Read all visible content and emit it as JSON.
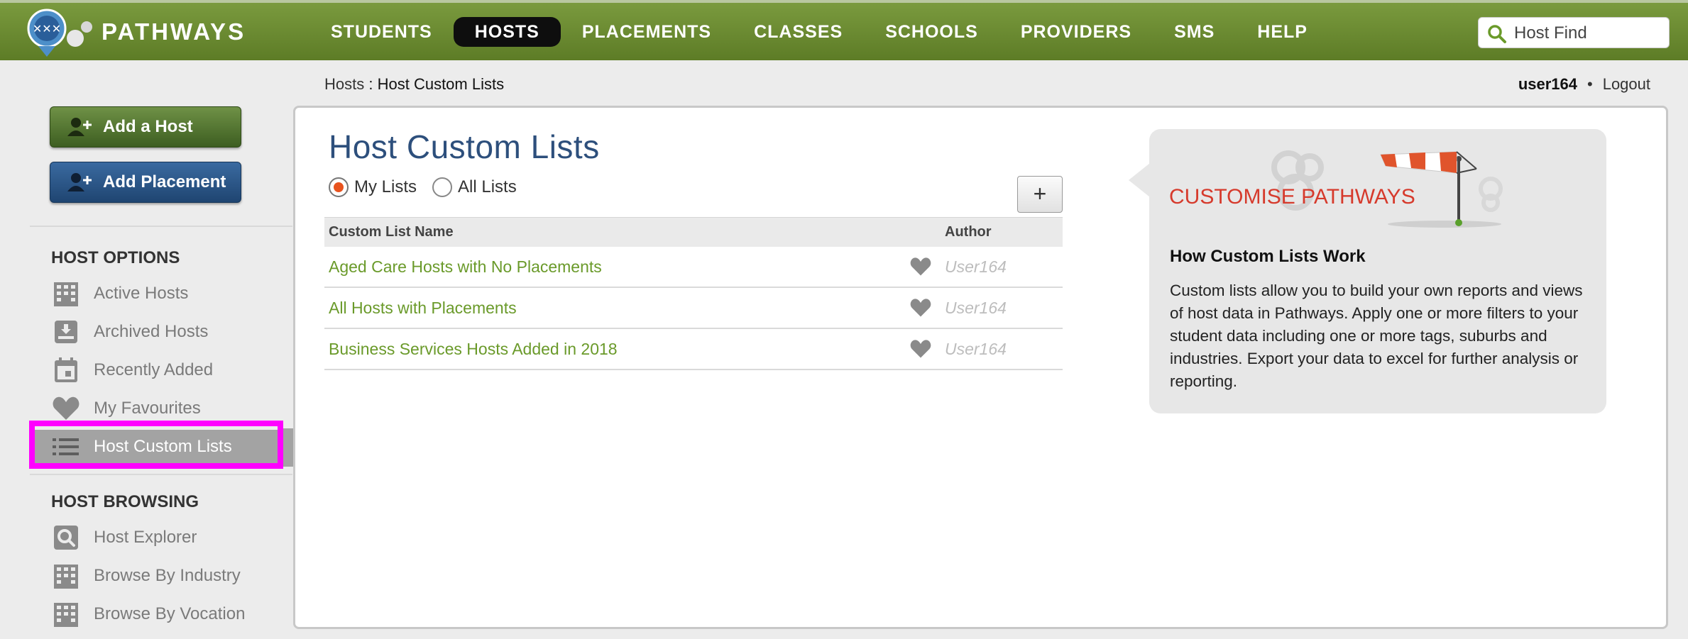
{
  "app": {
    "brand": "PATHWAYS"
  },
  "nav": [
    {
      "label": "STUDENTS",
      "active": false
    },
    {
      "label": "HOSTS",
      "active": true
    },
    {
      "label": "PLACEMENTS",
      "active": false
    },
    {
      "label": "CLASSES",
      "active": false
    },
    {
      "label": "SCHOOLS",
      "active": false
    },
    {
      "label": "PROVIDERS",
      "active": false
    },
    {
      "label": "SMS",
      "active": false
    },
    {
      "label": "HELP",
      "active": false
    }
  ],
  "search": {
    "placeholder": "Host Find"
  },
  "breadcrumb": {
    "parent": "Hosts",
    "separator": " : ",
    "current": "Host Custom Lists"
  },
  "user": {
    "name": "user164",
    "separator": "•",
    "logout": "Logout"
  },
  "sidebar": {
    "add_host": "Add a Host",
    "add_placement": "Add Placement",
    "host_options_title": "HOST OPTIONS",
    "host_options": [
      {
        "label": "Active Hosts",
        "icon": "building-icon"
      },
      {
        "label": "Archived Hosts",
        "icon": "archive-icon"
      },
      {
        "label": "Recently Added",
        "icon": "calendar-icon"
      },
      {
        "label": "My Favourites",
        "icon": "heart-icon"
      },
      {
        "label": "Host Custom Lists",
        "icon": "list-icon",
        "active": true
      }
    ],
    "host_browsing_title": "HOST BROWSING",
    "host_browsing": [
      {
        "label": "Host Explorer",
        "icon": "search-icon"
      },
      {
        "label": "Browse By Industry",
        "icon": "building-icon"
      },
      {
        "label": "Browse By Vocation",
        "icon": "building-icon"
      }
    ]
  },
  "main": {
    "title": "Host Custom Lists",
    "filters": [
      {
        "label": "My Lists",
        "checked": true
      },
      {
        "label": "All Lists",
        "checked": false
      }
    ],
    "add_button": "+",
    "columns": {
      "name": "Custom List Name",
      "author": "Author"
    },
    "rows": [
      {
        "name": "Aged Care Hosts with No Placements",
        "author": "User164"
      },
      {
        "name": "All Hosts with Placements",
        "author": "User164"
      },
      {
        "name": "Business Services Hosts Added in 2018",
        "author": "User164"
      }
    ]
  },
  "info": {
    "banner": "CUSTOMISE PATHWAYS",
    "heading": "How Custom Lists Work",
    "body": "Custom lists allow you to build your own reports and views of host data in Pathways. Apply one or more filters to your student data including one or more tags, suburbs and industries. Export your data to excel for further analysis or reporting."
  },
  "colors": {
    "topbar": "#6b8b32",
    "accent_orange": "#e8531e",
    "link_green": "#6a9a2a",
    "title_blue": "#2d4f7c",
    "highlight_magenta": "#ff00ff"
  }
}
